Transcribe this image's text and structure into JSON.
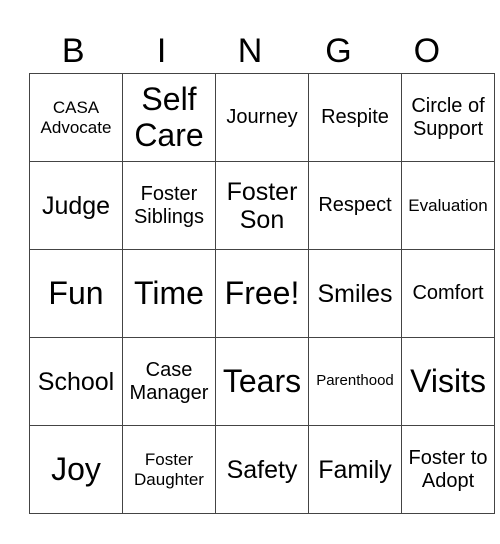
{
  "header": [
    "B",
    "I",
    "N",
    "G",
    "O"
  ],
  "rows": [
    [
      {
        "text": "CASA Advocate",
        "size": "s2"
      },
      {
        "text": "Self Care",
        "size": "s5"
      },
      {
        "text": "Journey",
        "size": "s3"
      },
      {
        "text": "Respite",
        "size": "s3"
      },
      {
        "text": "Circle of Support",
        "size": "s3"
      }
    ],
    [
      {
        "text": "Judge",
        "size": "s4"
      },
      {
        "text": "Foster Siblings",
        "size": "s3"
      },
      {
        "text": "Foster Son",
        "size": "s4"
      },
      {
        "text": "Respect",
        "size": "s3"
      },
      {
        "text": "Evaluation",
        "size": "s2"
      }
    ],
    [
      {
        "text": "Fun",
        "size": "s5"
      },
      {
        "text": "Time",
        "size": "s5"
      },
      {
        "text": "Free!",
        "size": "s5"
      },
      {
        "text": "Smiles",
        "size": "s4"
      },
      {
        "text": "Comfort",
        "size": "s3"
      }
    ],
    [
      {
        "text": "School",
        "size": "s4"
      },
      {
        "text": "Case Manager",
        "size": "s3"
      },
      {
        "text": "Tears",
        "size": "s5"
      },
      {
        "text": "Parenthood",
        "size": "s1"
      },
      {
        "text": "Visits",
        "size": "s5"
      }
    ],
    [
      {
        "text": "Joy",
        "size": "s5"
      },
      {
        "text": "Foster Daughter",
        "size": "s2"
      },
      {
        "text": "Safety",
        "size": "s4"
      },
      {
        "text": "Family",
        "size": "s4"
      },
      {
        "text": "Foster to Adopt",
        "size": "s3"
      }
    ]
  ]
}
